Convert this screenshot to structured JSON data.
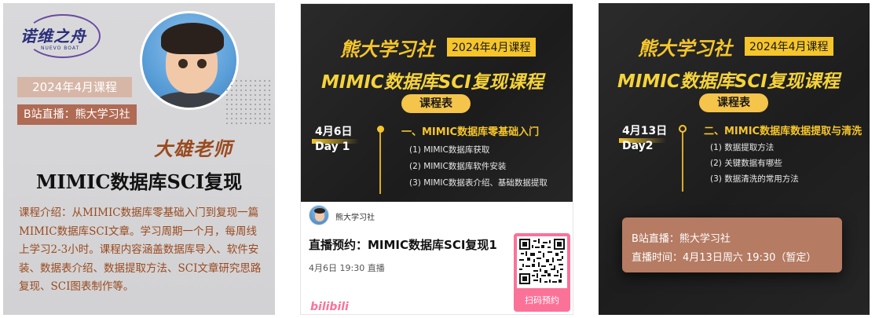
{
  "card1": {
    "logo_text": "诺维之舟",
    "logo_sub": "NUEVO BOAT",
    "course_tag": "2024年4月课程",
    "bili_tag": "B站直播：熊大学习社",
    "teacher": "大雄老师",
    "title": "MIMIC数据库SCI复现",
    "intro": "课程介绍：从MIMIC数据库零基础入门到复现一篇MIMIC数据库SCI文章。学习周期一个月，每周线上学习2-3小时。课程内容涵盖数据库导入、软件安装、数据表介绍、数据提取方法、SCI文章研究思路复现、SCI图表制作等。"
  },
  "card2": {
    "club": "熊大学习社",
    "month": "2024年4月课程",
    "big_title": "MIMIC数据库SCI复现课程",
    "schedule": "课程表",
    "date": "4月6日",
    "day": "Day 1",
    "section": "一、MIMIC数据库零基础入门",
    "items": [
      "(1) MIMIC数据库获取",
      "(2) MIMIC数据库软件安装",
      "(3) MIMIC数据表介绍、基础数据提取"
    ],
    "profile_name": "熊大学习社",
    "live_title": "直播预约：MIMIC数据库SCI复现1",
    "live_time": "4月6日 19:30 直播",
    "bili_logo": "bilibili",
    "qr_label": "扫码预约",
    "colors": {
      "accent": "#f5c52b",
      "pink": "#fb7299"
    }
  },
  "card3": {
    "club": "熊大学习社",
    "month": "2024年4月课程",
    "big_title": "MIMIC数据库SCI复现课程",
    "schedule": "课程表",
    "date": "4月13日",
    "day": "Day2",
    "section": "二、MIMIC数据库数据提取与清洗",
    "items": [
      "(1) 数据提取方法",
      "(2) 关键数据有哪些",
      "(3) 数据清洗的常用方法"
    ],
    "info_line1": "B站直播：熊大学习社",
    "info_line2": "直播时间：4月13日周六 19:30（暂定）"
  }
}
